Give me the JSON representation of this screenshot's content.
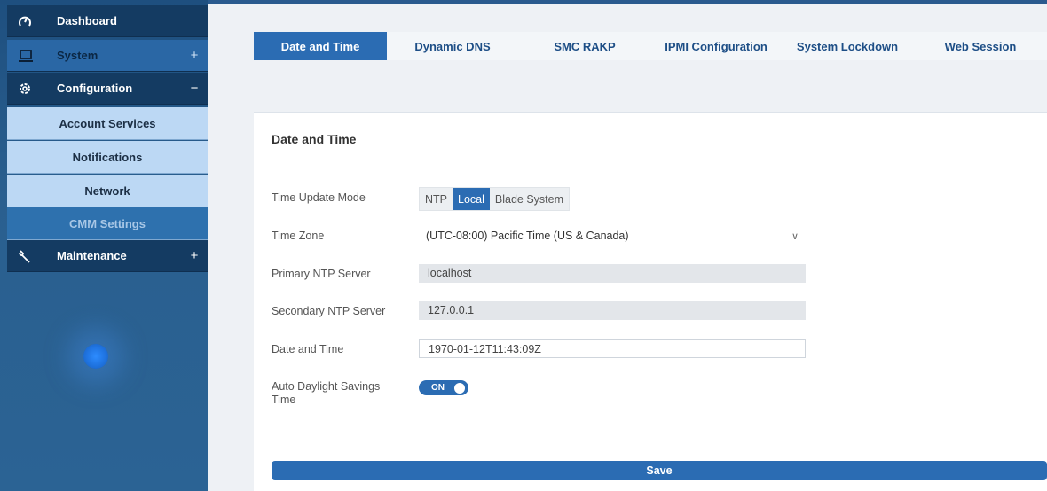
{
  "sidebar": {
    "dashboard": {
      "label": "Dashboard",
      "icon": "dashboard-gauge-icon"
    },
    "system": {
      "label": "System",
      "icon": "laptop-icon",
      "expander": "+"
    },
    "configuration": {
      "label": "Configuration",
      "icon": "gear-icon",
      "expander": "−"
    },
    "config_items": [
      "Account Services",
      "Notifications",
      "Network",
      "CMM Settings"
    ],
    "maintenance": {
      "label": "Maintenance",
      "icon": "wrench-icon",
      "expander": "+"
    }
  },
  "tabs": [
    "Date and Time",
    "Dynamic DNS",
    "SMC RAKP",
    "IPMI Configuration",
    "System Lockdown",
    "Web Session"
  ],
  "active_tab": "Date and Time",
  "panel": {
    "title": "Date and Time",
    "time_update_mode": {
      "label": "Time Update Mode",
      "options": [
        "NTP",
        "Local",
        "Blade System"
      ],
      "selected": "Local"
    },
    "time_zone": {
      "label": "Time Zone",
      "value": "(UTC-08:00) Pacific Time (US & Canada)"
    },
    "primary_ntp": {
      "label": "Primary NTP Server",
      "value": "localhost"
    },
    "secondary_ntp": {
      "label": "Secondary NTP Server",
      "value": "127.0.0.1"
    },
    "date_time": {
      "label": "Date and Time",
      "value": "1970-01-12T11:43:09Z"
    },
    "auto_dst": {
      "label": "Auto Daylight Savings Time",
      "state": "ON"
    },
    "save_label": "Save"
  },
  "colors": {
    "accent": "#2b6cb3",
    "sidebar_dark": "#143b62",
    "sub_item": "#bcd8f4"
  }
}
